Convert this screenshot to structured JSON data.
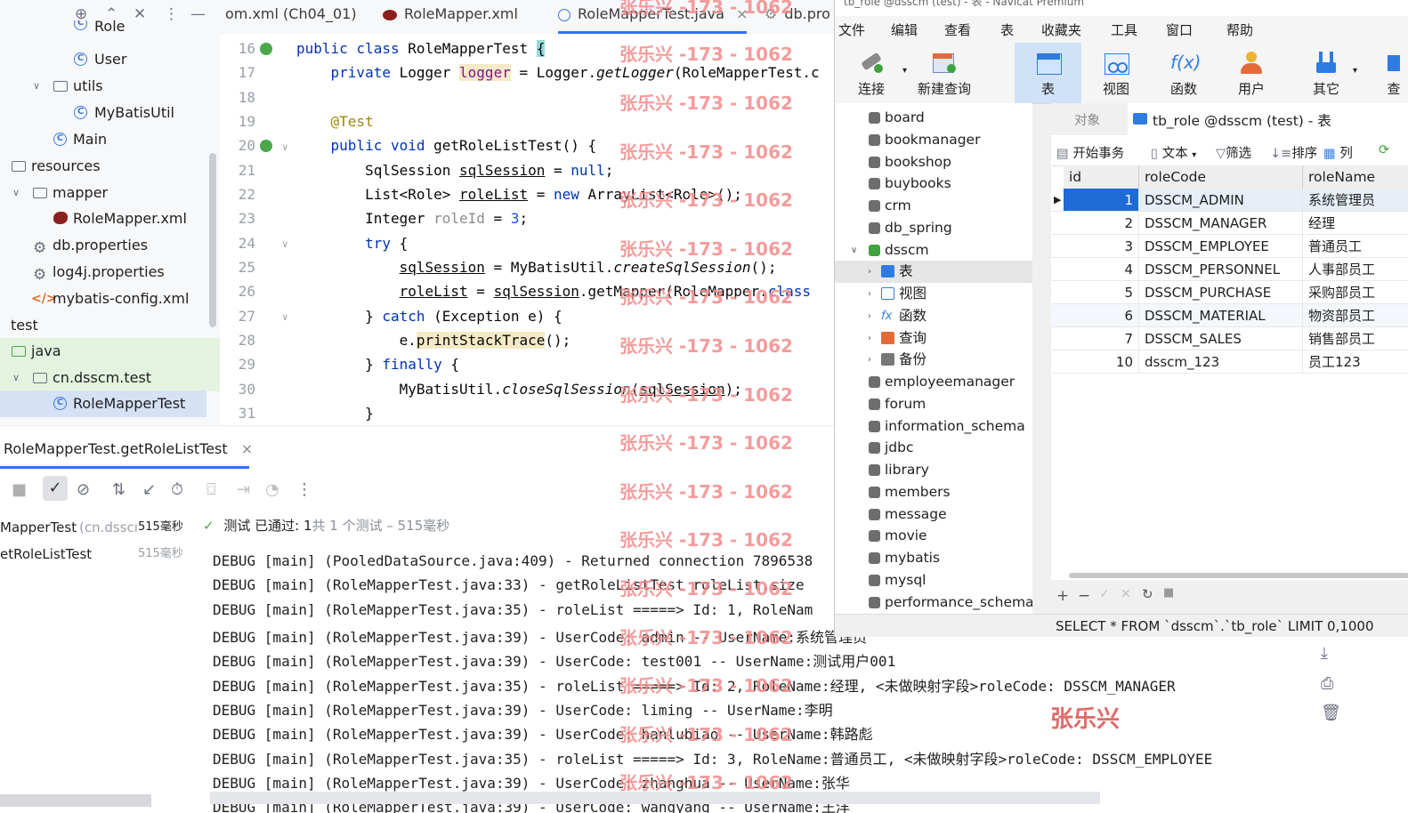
{
  "project_tree": {
    "items": [
      {
        "label": "Role",
        "icon": "class-icon"
      },
      {
        "label": "User",
        "icon": "class-icon"
      },
      {
        "label": "utils",
        "icon": "package-icon"
      },
      {
        "label": "MyBatisUtil",
        "icon": "class-icon"
      },
      {
        "label": "Main",
        "icon": "class-icon"
      },
      {
        "label": "resources",
        "icon": "folder-icon"
      },
      {
        "label": "mapper",
        "icon": "folder-icon"
      },
      {
        "label": "RoleMapper.xml",
        "icon": "mybatis-icon"
      },
      {
        "label": "db.properties",
        "icon": "properties-icon"
      },
      {
        "label": "log4j.properties",
        "icon": "properties-icon"
      },
      {
        "label": "mybatis-config.xml",
        "icon": "xml-icon"
      },
      {
        "label": "test",
        "icon": "folder-icon"
      },
      {
        "label": "java",
        "icon": "folder-icon"
      },
      {
        "label": "cn.dsscm.test",
        "icon": "package-icon"
      },
      {
        "label": "RoleMapperTest",
        "icon": "class-icon"
      }
    ]
  },
  "editor": {
    "tabs": [
      {
        "label": "om.xml (Ch04_01)"
      },
      {
        "label": "RoleMapper.xml"
      },
      {
        "label": "RoleMapperTest.java"
      },
      {
        "label": "db.pro"
      }
    ],
    "lines": [
      {
        "n": "16"
      },
      {
        "n": "17"
      },
      {
        "n": "18"
      },
      {
        "n": "19"
      },
      {
        "n": "20"
      },
      {
        "n": "21"
      },
      {
        "n": "22"
      },
      {
        "n": "23"
      },
      {
        "n": "24"
      },
      {
        "n": "25"
      },
      {
        "n": "26"
      },
      {
        "n": "27"
      },
      {
        "n": "28"
      },
      {
        "n": "29"
      },
      {
        "n": "30"
      },
      {
        "n": "31"
      }
    ],
    "code": {
      "l16_a": "public class ",
      "l16_b": "RoleMapperTest ",
      "l16_c": "{",
      "l17_a": "    private ",
      "l17_b": "Logger ",
      "l17_c": "logger",
      "l17_d": " = Logger.",
      "l17_e": "getLogger",
      "l17_f": "(RoleMapperTest.c",
      "l19": "    @Test",
      "l20_a": "    public void ",
      "l20_b": "getRoleListTest() {",
      "l21_a": "        SqlSession ",
      "l21_b": "sqlSession",
      "l21_c": " = ",
      "l21_d": "null",
      "l21_e": ";",
      "l22_a": "        List<Role> ",
      "l22_b": "roleList",
      "l22_c": " = ",
      "l22_d": "new ",
      "l22_e": "ArrayList<Role>();",
      "l23_a": "        Integer ",
      "l23_b": "roleId",
      "l23_c": " = ",
      "l23_d": "3",
      "l23_e": ";",
      "l24_a": "        try ",
      "l24_b": "{",
      "l25_a": "            ",
      "l25_b": "sqlSession",
      "l25_c": " = MyBatisUtil.",
      "l25_d": "createSqlSession",
      "l25_e": "();",
      "l26_a": "            ",
      "l26_b": "roleList",
      "l26_c": " = ",
      "l26_d": "sqlSession",
      "l26_e": ".getMapper(RoleMapper.",
      "l26_f": "class",
      "l27_a": "        } ",
      "l27_b": "catch ",
      "l27_c": "(Exception e) {",
      "l28_a": "            e.",
      "l28_b": "printStackTrace",
      "l28_c": "();",
      "l29_a": "        } ",
      "l29_b": "finally ",
      "l29_c": "{",
      "l30_a": "            MyBatisUtil.",
      "l30_b": "closeSqlSession",
      "l30_c": "(",
      "l30_d": "sqlSession",
      "l30_e": ");",
      "l31": "        }"
    }
  },
  "watermark": "张乐兴 -173 - 1062",
  "run_panel": {
    "tab_label": "RoleMapperTest.getRoleListTest",
    "tree": [
      {
        "name": "MapperTest",
        "pkg": "(cn.dsscı",
        "time": "515毫秒"
      },
      {
        "name": "etRoleListTest",
        "pkg": "",
        "time": "515毫秒"
      }
    ],
    "status_prefix": "测试 已通过: 1",
    "status_suffix": "共 1 个测试 – 515毫秒",
    "console_lines": [
      "DEBUG [main] (PooledDataSource.java:409) - Returned connection 7896538",
      "DEBUG [main] (RoleMapperTest.java:33) - getRoleListTest roleList.size",
      "DEBUG [main] (RoleMapperTest.java:35) - roleList =====> Id: 1, RoleNam",
      "DEBUG [main] (RoleMapperTest.java:39) - UserCode: admin -- UserName:系统管理员",
      "DEBUG [main] (RoleMapperTest.java:39) - UserCode: test001 -- UserName:测试用户001",
      "DEBUG [main] (RoleMapperTest.java:35) - roleList =====> Id: 2, RoleName:经理, <未做映射字段>roleCode: DSSCM_MANAGER",
      "DEBUG [main] (RoleMapperTest.java:39) - UserCode: liming -- UserName:李明",
      "DEBUG [main] (RoleMapperTest.java:39) - UserCode: hanlubiao -- UserName:韩路彪",
      "DEBUG [main] (RoleMapperTest.java:35) - roleList =====> Id: 3, RoleName:普通员工, <未做映射字段>roleCode: DSSCM_EMPLOYEE",
      "DEBUG [main] (RoleMapperTest.java:39) - UserCode: zhanghua -- UserName:张华",
      "DEBUG [main] (RoleMapperTest.java:39) - UserCode: wangyang -- UserName:王洋"
    ],
    "signature": "张乐兴"
  },
  "navicat": {
    "title": "tb_role @dsscm (test) - 表 - Navicat Premium",
    "menu": [
      "文件",
      "编辑",
      "查看",
      "表",
      "收藏夹",
      "工具",
      "窗口",
      "帮助"
    ],
    "ribbon": [
      {
        "label": "连接",
        "icon": "connect-icon"
      },
      {
        "label": "新建查询",
        "icon": "new-query-icon"
      },
      {
        "label": "表",
        "icon": "table-icon"
      },
      {
        "label": "视图",
        "icon": "view-icon"
      },
      {
        "label": "函数",
        "icon": "function-icon"
      },
      {
        "label": "用户",
        "icon": "user-icon"
      },
      {
        "label": "其它",
        "icon": "other-icon"
      },
      {
        "label": "查",
        "icon": "query-icon"
      }
    ],
    "databases": [
      "board",
      "bookmanager",
      "bookshop",
      "buybooks",
      "crm",
      "db_spring",
      "dsscm"
    ],
    "dsscm_children": [
      "表",
      "视图",
      "函数",
      "查询",
      "备份"
    ],
    "databases_after": [
      "employeemanager",
      "forum",
      "information_schema",
      "jdbc",
      "library",
      "members",
      "message",
      "movie",
      "mybatis",
      "mysql",
      "performance_schema"
    ],
    "object_tab": "对象",
    "table_tab": "tb_role @dsscm (test) - 表",
    "toolbar2": {
      "begin_tx": "开始事务",
      "text": "文本",
      "filter": "筛选",
      "sort": "排序",
      "columns": "列"
    },
    "grid": {
      "columns": [
        "id",
        "roleCode",
        "roleName"
      ],
      "rows": [
        {
          "id": "1",
          "roleCode": "DSSCM_ADMIN",
          "roleName": "系统管理员"
        },
        {
          "id": "2",
          "roleCode": "DSSCM_MANAGER",
          "roleName": "经理"
        },
        {
          "id": "3",
          "roleCode": "DSSCM_EMPLOYEE",
          "roleName": "普通员工"
        },
        {
          "id": "4",
          "roleCode": "DSSCM_PERSONNEL",
          "roleName": "人事部员工"
        },
        {
          "id": "5",
          "roleCode": "DSSCM_PURCHASE",
          "roleName": "采购部员工"
        },
        {
          "id": "6",
          "roleCode": "DSSCM_MATERIAL",
          "roleName": "物资部员工"
        },
        {
          "id": "7",
          "roleCode": "DSSCM_SALES",
          "roleName": "销售部员工"
        },
        {
          "id": "10",
          "roleCode": "dsscm_123",
          "roleName": "员工123"
        }
      ]
    },
    "status_sql": "SELECT * FROM `dsscm`.`tb_role` LIMIT 0,1000"
  }
}
